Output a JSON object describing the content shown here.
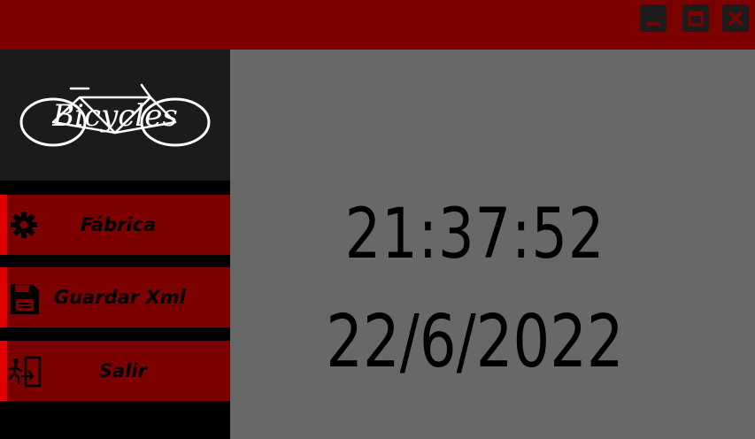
{
  "titlebar": {
    "background": "#7c0000",
    "buttons": [
      {
        "name": "minimize",
        "icon": "minimize-icon"
      },
      {
        "name": "maximize",
        "icon": "maximize-icon"
      },
      {
        "name": "close",
        "icon": "close-icon"
      }
    ]
  },
  "sidebar": {
    "logo": {
      "text": "Bicycles",
      "icon": "bicycle-logo-icon"
    },
    "items": [
      {
        "label": "Fábrica",
        "icon": "gear-icon"
      },
      {
        "label": "Guardar Xml",
        "icon": "floppy-disk-icon"
      },
      {
        "label": "Salir",
        "icon": "exit-door-icon"
      }
    ]
  },
  "main": {
    "time": "21:37:52",
    "date": "22/6/2022"
  },
  "colors": {
    "accent": "#e00000",
    "menu_bg": "#7c0000",
    "main_bg": "#686868",
    "logo_bg": "#1b1b1b"
  }
}
